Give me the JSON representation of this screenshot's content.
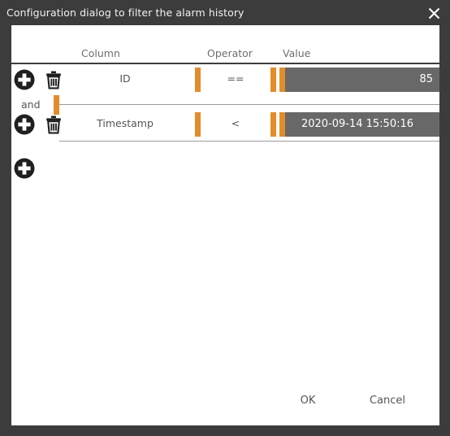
{
  "window": {
    "title": "Configuration dialog to filter the alarm history",
    "close_icon": "close-icon"
  },
  "table": {
    "headers": {
      "column": "Column",
      "operator": "Operator",
      "value": "Value"
    },
    "rows": [
      {
        "add_icon": "plus-circle-icon",
        "delete_icon": "trash-icon",
        "column": "ID",
        "operator": "==",
        "value": "85"
      },
      {
        "add_icon": "plus-circle-icon",
        "delete_icon": "trash-icon",
        "column": "Timestamp",
        "operator": "<",
        "value": "2020-09-14 15:50:16"
      }
    ],
    "conjunction": "and",
    "add_row_icon": "plus-circle-icon"
  },
  "footer": {
    "ok_label": "OK",
    "cancel_label": "Cancel"
  },
  "colors": {
    "accent": "#e38c2b",
    "window_chrome": "#3c3c3c",
    "value_field": "#686868",
    "text_muted": "#6e6e6e"
  }
}
